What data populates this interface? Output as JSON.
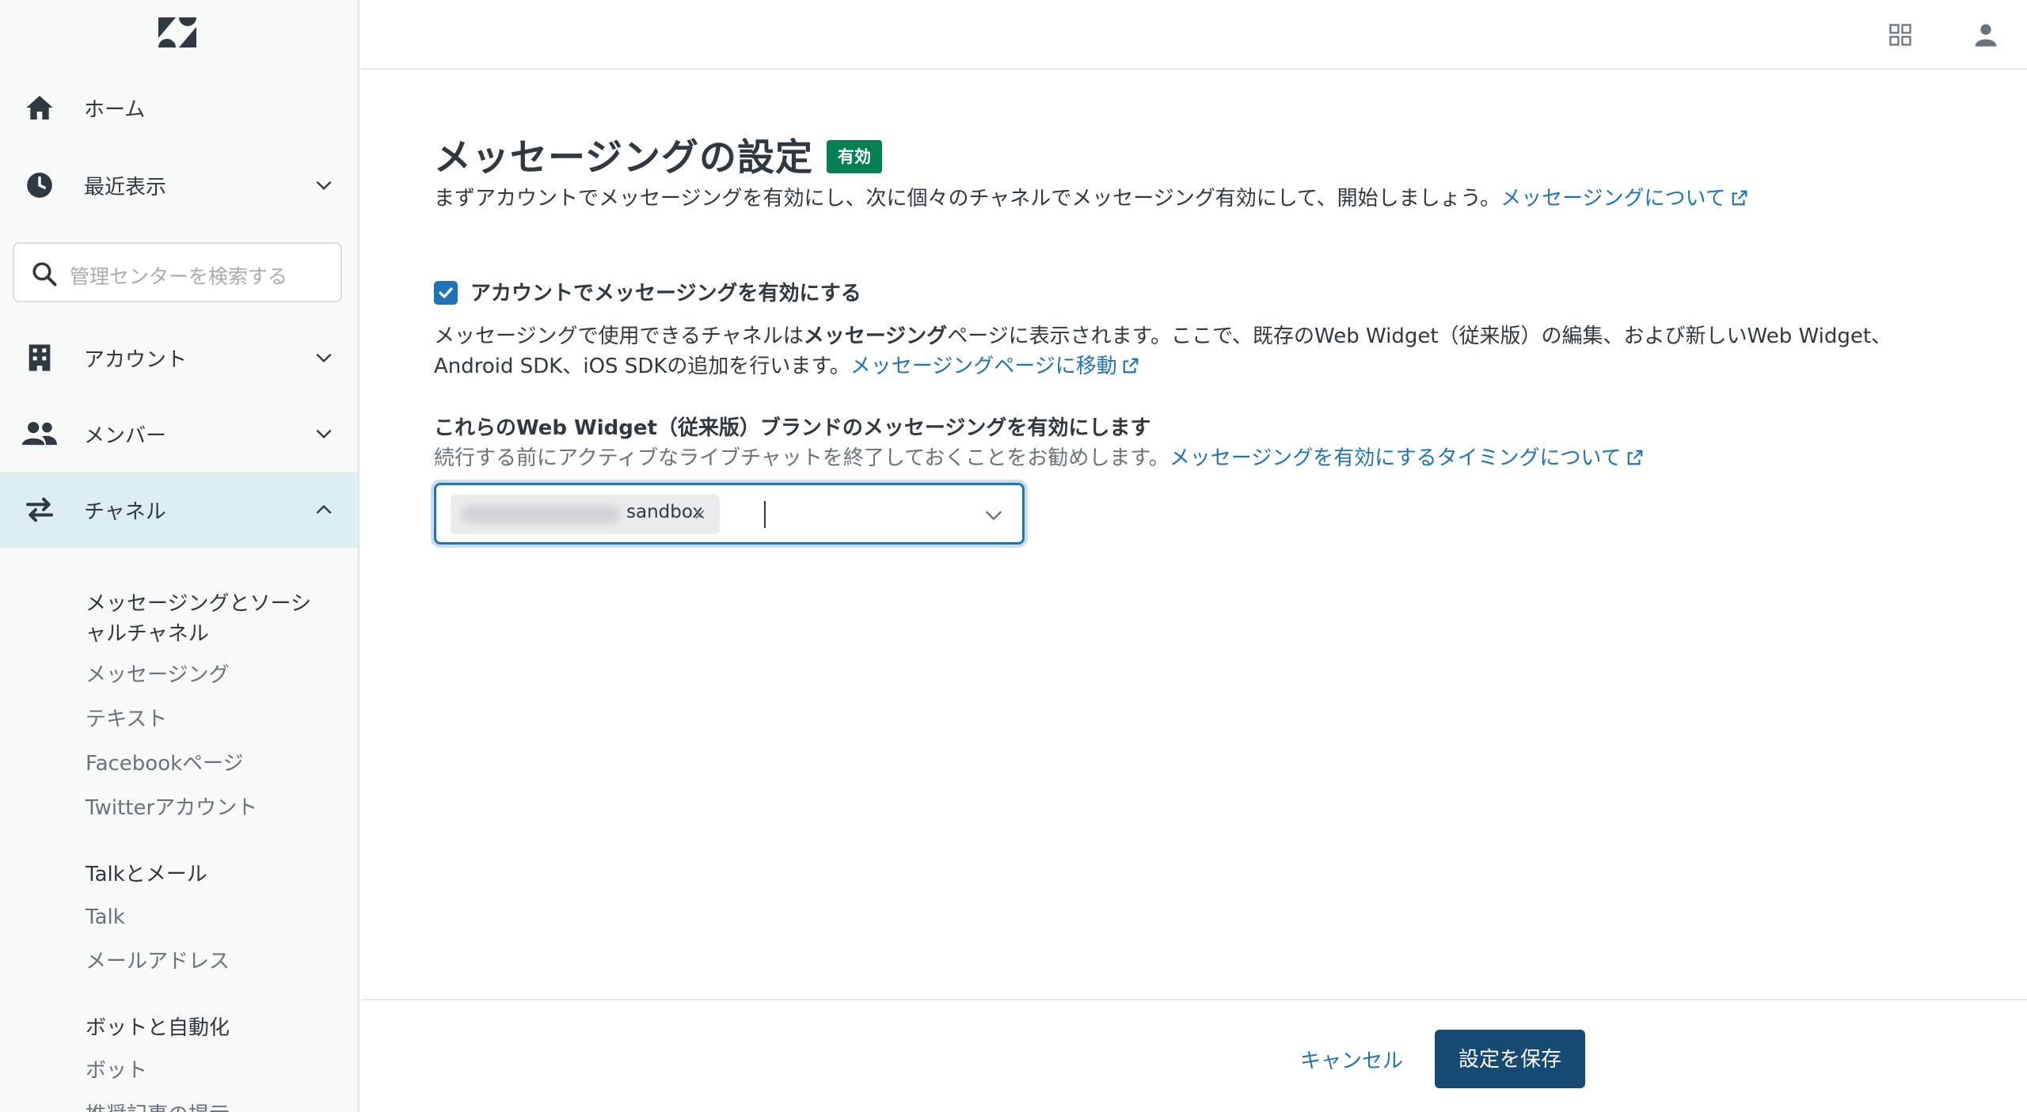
{
  "sidebar": {
    "home": "ホーム",
    "recent": "最近表示",
    "search_placeholder": "管理センターを検索する",
    "account": "アカウント",
    "members": "メンバー",
    "channels": "チャネル",
    "sub_items": {
      "messaging_social": "メッセージングとソーシャルチャネル",
      "messaging": "メッセージング",
      "text": "テキスト",
      "facebook": "Facebookページ",
      "twitter": "Twitterアカウント",
      "talk_email": "Talkとメール",
      "talk": "Talk",
      "email_address": "メールアドレス",
      "bots_automation": "ボットと自動化",
      "bots": "ボット",
      "article_suggestions": "推奨記事の提示"
    }
  },
  "main": {
    "title": "メッセージングの設定",
    "badge": "有効",
    "intro_text": "まずアカウントでメッセージングを有効にし、次に個々のチャネルでメッセージング有効にして、開始しましょう。",
    "intro_link": "メッセージングについて",
    "checkbox_label": "アカウントでメッセージングを有効にする",
    "checkbox_checked": true,
    "desc_part1": "メッセージングで使用できるチャネルは",
    "desc_bold": "メッセージング",
    "desc_part2": "ページに表示されます。ここで、既存のWeb Widget（従来版）の編集、および新しいWeb Widget、Android SDK、iOS SDKの追加を行います。",
    "desc_link": "メッセージングページに移動",
    "field_label": "これらのWeb Widget（従来版）ブランドのメッセージングを有効にします",
    "field_hint": "続行する前にアクティブなライブチャットを終了しておくことをお勧めします。",
    "field_hint_link": "メッセージングを有効にするタイミングについて",
    "selected_tag": "sandbox"
  },
  "footer": {
    "cancel": "キャンセル",
    "save": "設定を保存"
  },
  "colors": {
    "accent": "#1f73b7",
    "badge_green": "#038153",
    "save_button": "#144a74",
    "active_nav": "#dceeef"
  }
}
